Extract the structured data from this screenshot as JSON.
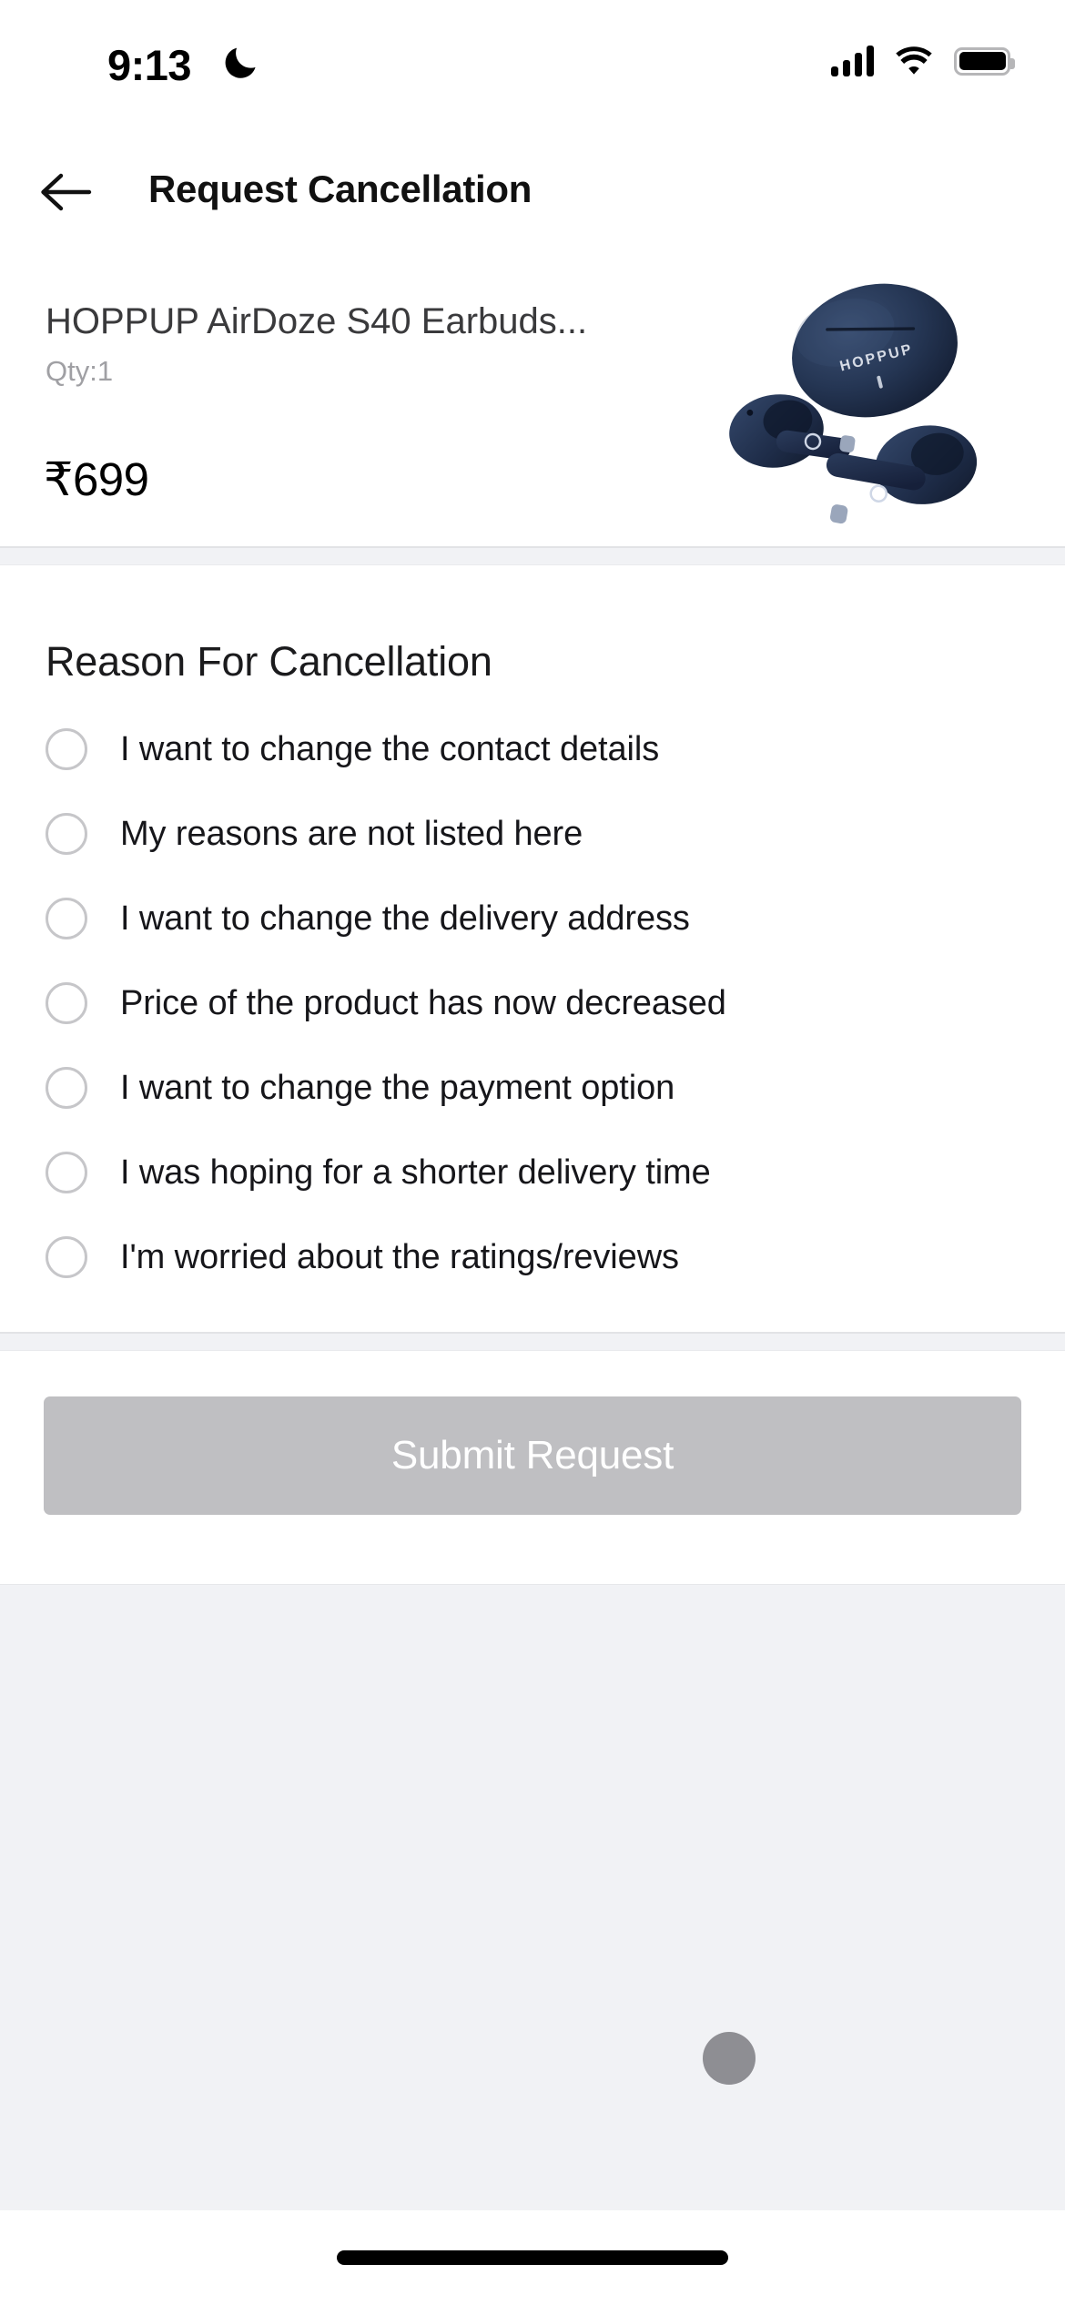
{
  "status_bar": {
    "time": "9:13",
    "dnd_icon": "crescent-moon-icon",
    "cellular_icon": "cellular-signal-icon",
    "cellular_bars": 4,
    "wifi_icon": "wifi-icon",
    "battery_icon": "battery-full-icon"
  },
  "header": {
    "back_icon": "arrow-left-icon",
    "title": "Request Cancellation"
  },
  "product": {
    "title": "HOPPUP AirDoze S40 Earbuds...",
    "qty_label": "Qty:1",
    "price": "₹699",
    "image_name": "hoppup-airdoze-s40-earbuds-image",
    "image_brand_text": "HOPPUP",
    "image_color": "#1d2a44"
  },
  "reasons": {
    "heading": "Reason For Cancellation",
    "selected_index": null,
    "options": [
      {
        "label": "I want to change the contact details",
        "selected": false
      },
      {
        "label": "My reasons are not listed here",
        "selected": false
      },
      {
        "label": "I want to change the delivery address",
        "selected": false
      },
      {
        "label": "Price of the product has now decreased",
        "selected": false
      },
      {
        "label": "I want to change the payment option",
        "selected": false
      },
      {
        "label": "I was hoping for a shorter delivery time",
        "selected": false
      },
      {
        "label": "I'm worried about the ratings/reviews",
        "selected": false
      }
    ]
  },
  "submit": {
    "label": "Submit Request",
    "enabled": false,
    "color": "#bfbfc2",
    "text_color": "#ffffff"
  },
  "touch_indicator": {
    "name": "touch-point-indicator",
    "color": "#8e8e93"
  },
  "home_indicator": {
    "name": "home-indicator"
  },
  "theme": {
    "page_background": "#ffffff",
    "section_gap_background": "#f1f2f5",
    "muted_text": "#a0a0a4",
    "primary_text": "#16161a"
  }
}
